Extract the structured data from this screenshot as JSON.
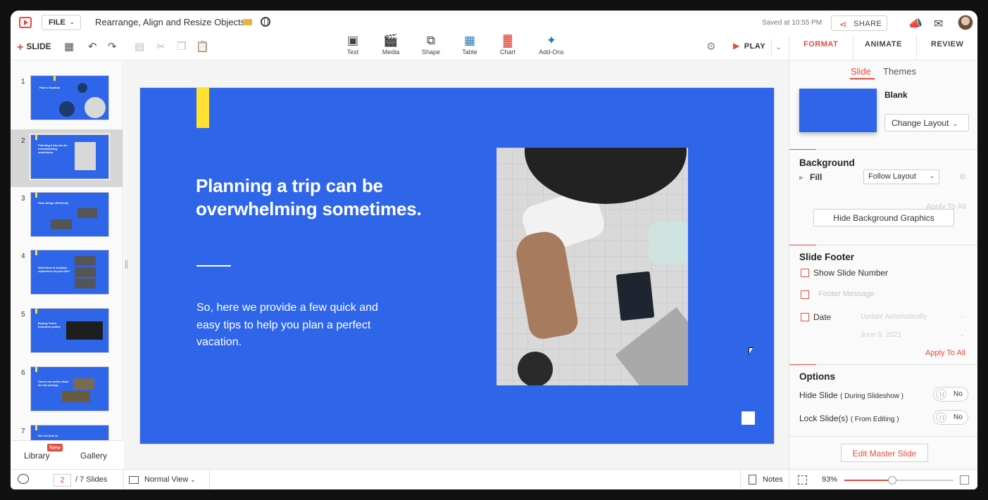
{
  "header": {
    "file_label": "FILE",
    "doc_title": "Rearrange, Align and Resize Objects",
    "saved_text": "Saved at 10:55 PM",
    "share_label": "SHARE",
    "icons": [
      "slide-show-logo-icon",
      "folder-icon",
      "globe-icon",
      "megaphone-icon",
      "mail-icon",
      "avatar"
    ]
  },
  "toolbar": {
    "slide_label": "SLIDE",
    "insert": [
      {
        "label": "Text",
        "icon": "text-box-icon"
      },
      {
        "label": "Media",
        "icon": "media-icon"
      },
      {
        "label": "Shape",
        "icon": "shape-icon"
      },
      {
        "label": "Table",
        "icon": "table-icon"
      },
      {
        "label": "Chart",
        "icon": "chart-icon"
      },
      {
        "label": "Add-Ons",
        "icon": "puzzle-icon"
      }
    ],
    "play_label": "PLAY"
  },
  "right_tabs": [
    "FORMAT",
    "ANIMATE",
    "REVIEW"
  ],
  "thumbnails": [
    {
      "num": "1",
      "title": "Plan a Vacation"
    },
    {
      "num": "2",
      "title": "Planning a trip can be overwhelming sometimes."
    },
    {
      "num": "3",
      "title": "Pack things effectively"
    },
    {
      "num": "4",
      "title": "What kind of vacation experience do you like?"
    },
    {
      "num": "5",
      "title": "Buying Travel Insurance policy"
    },
    {
      "num": "6",
      "title": "Check out online deals for trip savings"
    },
    {
      "num": "7",
      "title": "See it's time to"
    }
  ],
  "left_footer": {
    "library": "Library",
    "new_badge": "New",
    "gallery": "Gallery"
  },
  "slide": {
    "title": "Planning a trip can be overwhelming sometimes.",
    "body": "So, here we provide a few quick and easy tips to help you plan a perfect vacation."
  },
  "format_panel": {
    "sub_tabs": [
      "Slide",
      "Themes"
    ],
    "layout_name": "Blank",
    "change_layout": "Change Layout",
    "background": {
      "title": "Background",
      "fill_label": "Fill",
      "fill_value": "Follow Layout",
      "apply_all": "Apply To All",
      "hide_graphics": "Hide Background Graphics"
    },
    "footer": {
      "title": "Slide Footer",
      "show_number": "Show Slide Number",
      "footer_message": "Footer Message",
      "date": "Date",
      "date_mode": "Update Automatically",
      "date_value": "June 9, 2021",
      "apply_all": "Apply To All"
    },
    "options": {
      "title": "Options",
      "hide_slide": "Hide Slide",
      "hide_slide_note": "( During Slideshow )",
      "hide_value": "No",
      "lock_slide": "Lock Slide(s)",
      "lock_slide_note": "( From Editing )",
      "lock_value": "No"
    },
    "edit_master": "Edit Master Slide"
  },
  "status": {
    "current_page": "2",
    "total": "/ 7 Slides",
    "view_mode": "Normal View",
    "notes": "Notes",
    "zoom": "93%",
    "zoom_fraction": 0.44
  },
  "colors": {
    "accent": "#e34b3b",
    "slide_blue": "#2f66e9",
    "slide_yellow": "#ffe033"
  }
}
